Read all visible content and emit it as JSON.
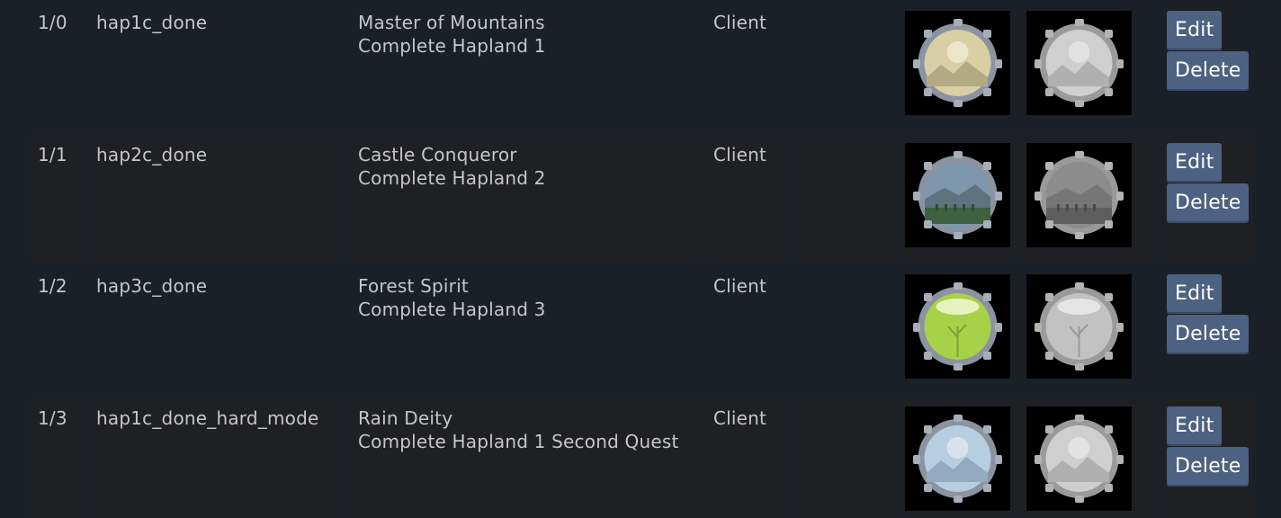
{
  "rows": [
    {
      "id": "1/0",
      "key": "hap1c_done",
      "name": "Master of Mountains",
      "description": "Complete Hapland 1",
      "type": "Client",
      "icon_unlocked": "mountain-achievement-icon",
      "icon_locked": "mountain-achievement-locked-icon",
      "edit_label": "Edit",
      "delete_label": "Delete"
    },
    {
      "id": "1/1",
      "key": "hap2c_done",
      "name": "Castle Conqueror",
      "description": "Complete Hapland 2",
      "type": "Client",
      "icon_unlocked": "castle-achievement-icon",
      "icon_locked": "castle-achievement-locked-icon",
      "edit_label": "Edit",
      "delete_label": "Delete"
    },
    {
      "id": "1/2",
      "key": "hap3c_done",
      "name": "Forest Spirit",
      "description": "Complete Hapland 3",
      "type": "Client",
      "icon_unlocked": "forest-achievement-icon",
      "icon_locked": "forest-achievement-locked-icon",
      "edit_label": "Edit",
      "delete_label": "Delete"
    },
    {
      "id": "1/3",
      "key": "hap1c_done_hard_mode",
      "name": "Rain Deity",
      "description": "Complete Hapland 1 Second Quest",
      "type": "Client",
      "icon_unlocked": "rain-achievement-icon",
      "icon_locked": "rain-achievement-locked-icon",
      "edit_label": "Edit",
      "delete_label": "Delete"
    }
  ],
  "colors": {
    "page_background": "#1b2027",
    "alt_row_background": "#1f2024",
    "button_background": "#4d6182",
    "text": "#c6c6c6",
    "icon_frame": "#8c93a0",
    "mountain_sky": "#d8cfa4",
    "castle_sky": "#7f97ac",
    "forest_sky": "#a8d14a",
    "rain_sky": "#b7cde0"
  }
}
